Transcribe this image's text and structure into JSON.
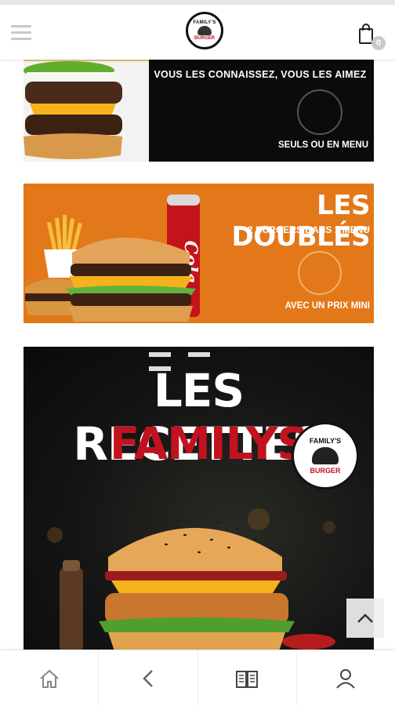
{
  "header": {
    "menu_icon": "hamburger-icon",
    "logo_text_top": "FAMILY'S",
    "logo_text_bottom": "BURGER",
    "cart_icon": "shopping-bag-icon",
    "cart_count": "0"
  },
  "banners": [
    {
      "tagline": "VOUS LES CONNAISSEZ, VOUS LES AIMEZ",
      "footer": "SEULS OU EN MENU"
    },
    {
      "title": "LES DOUBLÉS",
      "subtitle": "2 BURGERS DANS 1 MENU",
      "footer": "AVEC UN PRIX MINI",
      "can_text": "Cola"
    },
    {
      "line1": "LES RECETTES",
      "line2": "FAMILYS",
      "seal_top": "FAMILY'S",
      "seal_bottom": "BURGER"
    }
  ],
  "scroll_top_icon": "chevron-up-icon",
  "bottom_nav": [
    {
      "icon": "home-icon"
    },
    {
      "icon": "back-arrow-icon"
    },
    {
      "icon": "book-menu-icon"
    },
    {
      "icon": "user-icon"
    }
  ],
  "colors": {
    "accent_orange": "#e3781a",
    "brand_red": "#c1121f",
    "dark": "#0b0b0b"
  }
}
